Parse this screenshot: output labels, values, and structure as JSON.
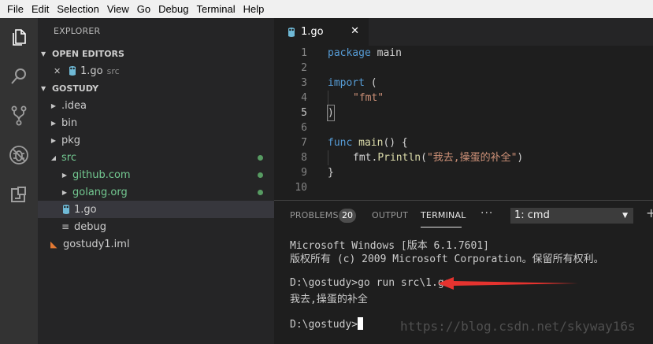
{
  "menu": [
    "File",
    "Edit",
    "Selection",
    "View",
    "Go",
    "Debug",
    "Terminal",
    "Help"
  ],
  "activity_icons": [
    "explorer-icon",
    "search-icon",
    "source-control-icon",
    "debug-icon",
    "extensions-icon"
  ],
  "sidebar": {
    "title": "EXPLORER",
    "open_editors_title": "OPEN EDITORS",
    "open_editor": {
      "close": "✕",
      "file": "1.go",
      "folder": "src"
    },
    "project_title": "GOSTUDY",
    "tree": [
      {
        "label": ".idea",
        "type": "folder"
      },
      {
        "label": "bin",
        "type": "folder"
      },
      {
        "label": "pkg",
        "type": "folder"
      },
      {
        "label": "src",
        "type": "folder-open"
      },
      {
        "label": "github.com",
        "type": "folder"
      },
      {
        "label": "golang.org",
        "type": "folder"
      },
      {
        "label": "1.go",
        "type": "go-file"
      },
      {
        "label": "debug",
        "type": "file"
      },
      {
        "label": "gostudy1.iml",
        "type": "xml-file"
      }
    ]
  },
  "editor": {
    "tab": {
      "label": "1.go",
      "close": "✕"
    },
    "line_numbers": [
      "1",
      "2",
      "3",
      "4",
      "5",
      "6",
      "7",
      "8",
      "9",
      "10"
    ],
    "code": {
      "l1_kw": "package",
      "l1_rest": " main",
      "l3_kw": "import",
      "l3_rest": " (",
      "l4": "\"fmt\"",
      "l5": ")",
      "l7_kw": "func",
      "l7_fn": " main",
      "l7_rest": "() {",
      "l8_pkg": "fmt.",
      "l8_fn": "Println",
      "l8_open": "(",
      "l8_str": "\"我去,操蛋的补全\"",
      "l8_close": ")",
      "l9": "}"
    }
  },
  "panel": {
    "tabs": [
      "PROBLEMS",
      "OUTPUT",
      "TERMINAL"
    ],
    "problems_count": "20",
    "more": "···",
    "terminal_select": "1: cmd",
    "plus": "+",
    "terminal_lines": [
      "Microsoft Windows [版本 6.1.7601]",
      "版权所有 (c) 2009 Microsoft Corporation。保留所有权利。",
      "",
      "D:\\gostudy>go run src\\1.go",
      "我去,操蛋的补全",
      "",
      "D:\\gostudy>"
    ]
  },
  "watermark": "https://blog.csdn.net/skyway16s",
  "colors": {
    "arrow": "#e5332f",
    "keyword": "#569cd6",
    "string": "#ce9178",
    "function": "#dcdcaa",
    "git_added": "#73c991"
  }
}
